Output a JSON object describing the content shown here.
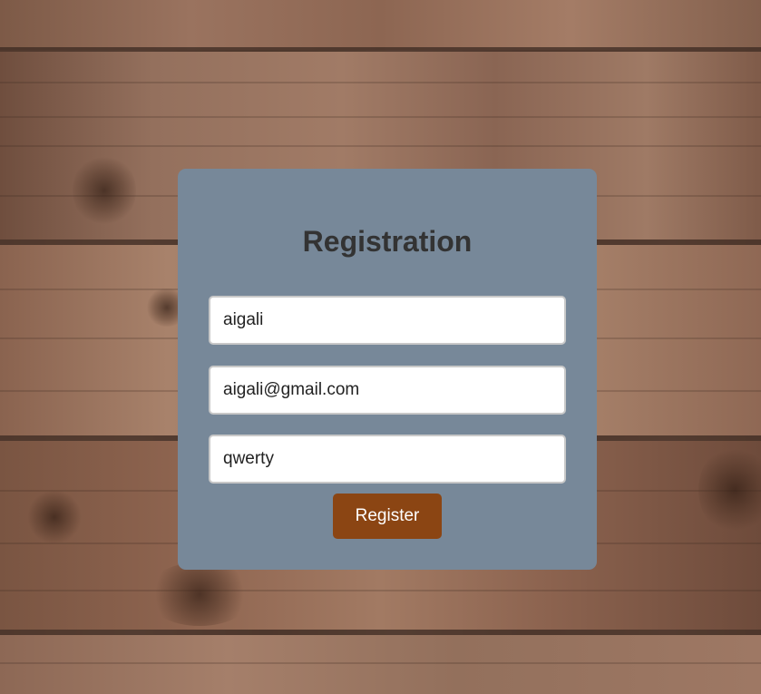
{
  "form": {
    "title": "Registration",
    "username_value": "aigali",
    "email_value": "aigali@gmail.com",
    "password_value": "qwerty",
    "submit_label": "Register"
  },
  "colors": {
    "card_background": "#778899",
    "title_text": "#333333",
    "button_background": "#8b4513",
    "button_text": "#ffffff"
  }
}
